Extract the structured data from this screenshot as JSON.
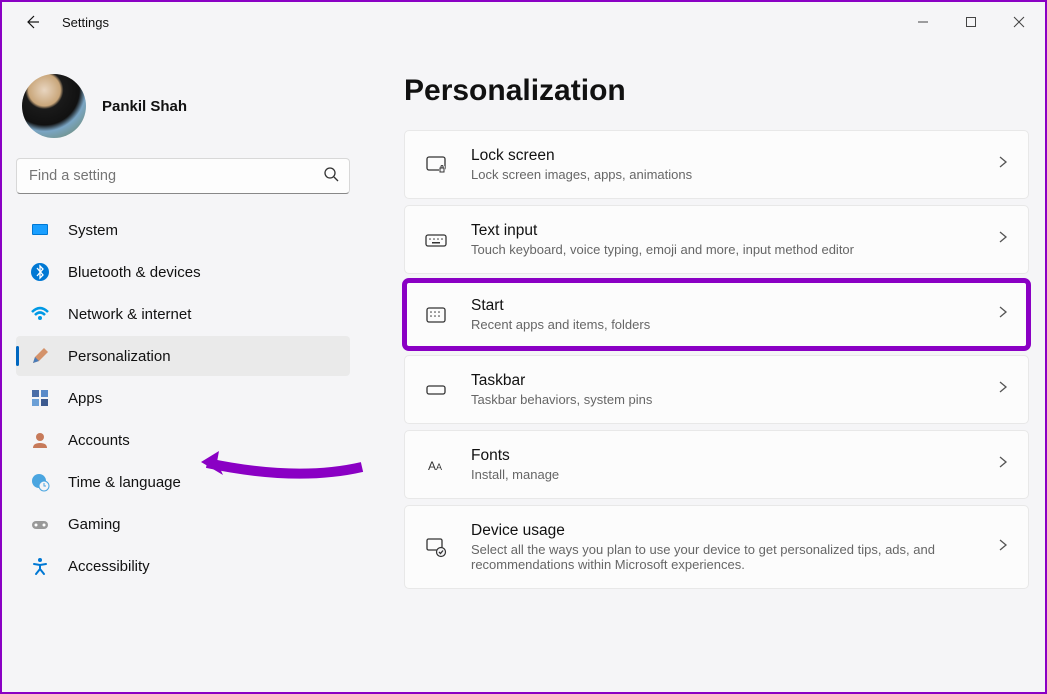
{
  "app": {
    "title": "Settings"
  },
  "profile": {
    "name": "Pankil Shah"
  },
  "search": {
    "placeholder": "Find a setting"
  },
  "nav": [
    {
      "label": "System"
    },
    {
      "label": "Bluetooth & devices"
    },
    {
      "label": "Network & internet"
    },
    {
      "label": "Personalization"
    },
    {
      "label": "Apps"
    },
    {
      "label": "Accounts"
    },
    {
      "label": "Time & language"
    },
    {
      "label": "Gaming"
    },
    {
      "label": "Accessibility"
    }
  ],
  "page": {
    "title": "Personalization"
  },
  "cards": [
    {
      "title": "Lock screen",
      "subtitle": "Lock screen images, apps, animations"
    },
    {
      "title": "Text input",
      "subtitle": "Touch keyboard, voice typing, emoji and more, input method editor"
    },
    {
      "title": "Start",
      "subtitle": "Recent apps and items, folders"
    },
    {
      "title": "Taskbar",
      "subtitle": "Taskbar behaviors, system pins"
    },
    {
      "title": "Fonts",
      "subtitle": "Install, manage"
    },
    {
      "title": "Device usage",
      "subtitle": "Select all the ways you plan to use your device to get personalized tips, ads, and recommendations within Microsoft experiences."
    }
  ]
}
